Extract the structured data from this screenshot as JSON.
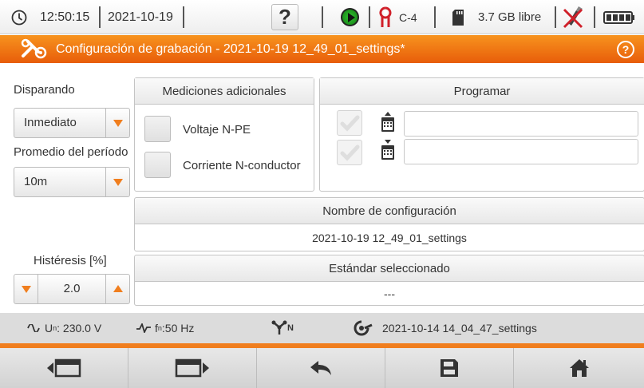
{
  "status_bar": {
    "time": "12:50:15",
    "date": "2021-10-19",
    "help_label": "?",
    "channel": "C-4",
    "storage": "3.7 GB libre",
    "icons": [
      "clock-icon",
      "help-button",
      "recording-play-icon",
      "clamp-probe-icon",
      "sd-card-icon",
      "no-usb-icon",
      "battery-icon"
    ]
  },
  "title_bar": {
    "title": "Configuración de grabación - 2021-10-19 12_49_01_settings*",
    "icon": "settings-tools-icon",
    "help_icon": "?"
  },
  "left": {
    "trigger_label": "Disparando",
    "trigger_value": "Inmediato",
    "avg_label": "Promedio del período",
    "avg_value": "10m",
    "hysteresis_label": "Histéresis [%]",
    "hysteresis_value": "2.0"
  },
  "additional": {
    "header": "Mediciones adicionales",
    "items": [
      {
        "label": "Voltaje N-PE",
        "checked": false
      },
      {
        "label": "Corriente N-conductor",
        "checked": false
      }
    ]
  },
  "schedule": {
    "header": "Programar",
    "start_value": "",
    "end_value": ""
  },
  "config_name": {
    "header": "Nombre de configuración",
    "value": "2021-10-19 12_49_01_settings"
  },
  "standard": {
    "header": "Estándar seleccionado",
    "value": "---"
  },
  "info_bar": {
    "voltage_prefix": "U",
    "voltage_sub": "n",
    "voltage_value": ": 230.0 V",
    "freq_prefix": "f",
    "freq_sub": "n",
    "freq_value": ":50 Hz",
    "network_sub": "N",
    "settings_file": "2021-10-14 14_04_47_settings"
  },
  "toolbar": {
    "buttons": [
      "screen-prev-icon",
      "screen-next-icon",
      "back-icon",
      "save-icon",
      "home-icon"
    ]
  },
  "colors": {
    "accent": "#f07e1e",
    "title_bar": "#e85d0a",
    "info_bar": "#dcdcdc"
  }
}
